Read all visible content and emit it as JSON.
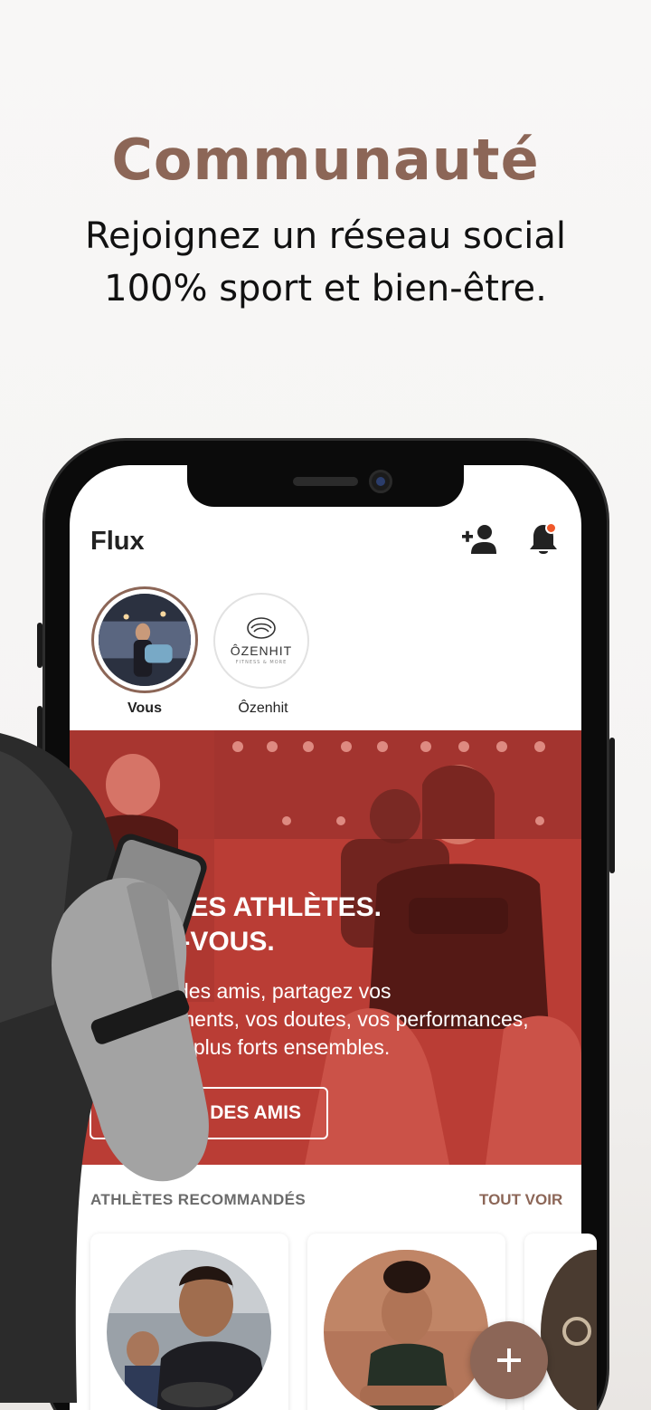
{
  "hero": {
    "title": "Communauté",
    "subtitle": "Rejoignez un réseau social\n100% sport et bien-être."
  },
  "app": {
    "header": {
      "title": "Flux"
    },
    "stories": [
      {
        "label": "Vous"
      },
      {
        "label": "Ôzenhit",
        "logo_text": "ÔZENHIT",
        "logo_tag": "FITNESS & MORE"
      }
    ],
    "banner": {
      "headline": "Z DES ATHLÈTES.\nEZ-VOUS.",
      "body": "des amis, partagez vos\nments, vos doutes, vos performances,\nz plus forts ensembles.",
      "button": "DES AMIS"
    },
    "recommended": {
      "title": "ATHLÈTES RECOMMANDÉS",
      "see_all": "TOUT VOIR"
    },
    "fab_icon": "plus-icon"
  },
  "colors": {
    "accent": "#8c6657",
    "notification": "#f0582a",
    "banner": "#c8473d"
  }
}
